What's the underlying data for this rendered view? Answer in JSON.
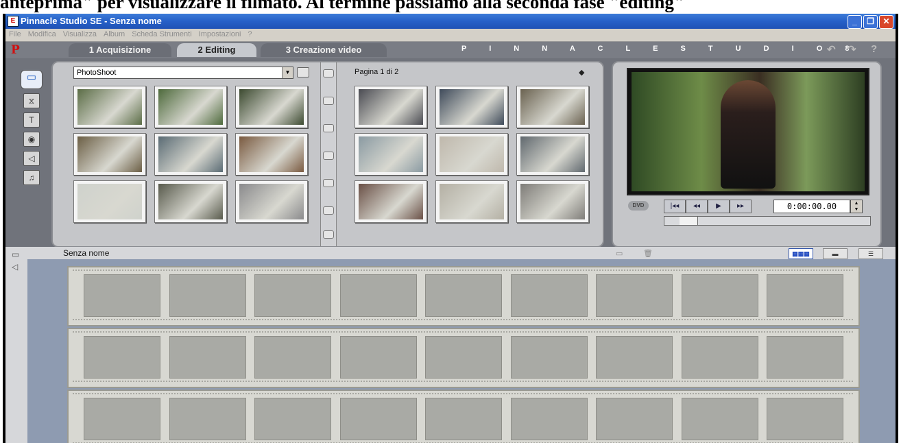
{
  "caption": "anteprima\" per visualizzare il filmato. Al termine passiamo alla seconda fase \"editing\"",
  "window": {
    "title": "Pinnacle Studio SE - Senza nome",
    "buttons": {
      "minimize": "_",
      "restore": "❐",
      "close": "✕"
    }
  },
  "menu": [
    "File",
    "Modifica",
    "Visualizza",
    "Album",
    "Scheda Strumenti",
    "Impostazioni",
    "?"
  ],
  "tabs": [
    {
      "label": "1 Acquisizione",
      "active": false
    },
    {
      "label": "2 Editing",
      "active": true
    },
    {
      "label": "3 Creazione video",
      "active": false
    }
  ],
  "brand": "P I N N A C L E   S T U D I O   8",
  "nav": {
    "undo": "↶",
    "redo": "↷",
    "help": "?"
  },
  "album": {
    "collection": "PhotoShoot",
    "page_label": "Pagina 1 di 2",
    "next_icon": "arrow-right-icon"
  },
  "thumb_colors": {
    "left": [
      [
        "#5b6d46",
        "#4e6a3c",
        "#3c4a30"
      ],
      [
        "#6b5e44",
        "#5a6b74",
        "#7a5a40"
      ],
      [
        "#cfd2cc",
        "#585a4c",
        "#8a8a8c"
      ]
    ],
    "right": [
      [
        "#4a4b52",
        "#3e4a5a",
        "#6a6250"
      ],
      [
        "#8a9aa2",
        "#bfb8ac",
        "#60686e"
      ],
      [
        "#6a5046",
        "#b4b0a4",
        "#7e7c78"
      ]
    ]
  },
  "player": {
    "dvd_label": "DVD",
    "buttons": [
      "|◂◂",
      "◂◂",
      "▶",
      "▸▸"
    ],
    "timecode": "0:00:00.00",
    "scrub_position": 0.08
  },
  "project": {
    "name": "Senza nome",
    "view_buttons": [
      "▦▦▦",
      "▬",
      "☰"
    ]
  },
  "storyboard": {
    "rows": 3,
    "frames_per_row": 9
  }
}
